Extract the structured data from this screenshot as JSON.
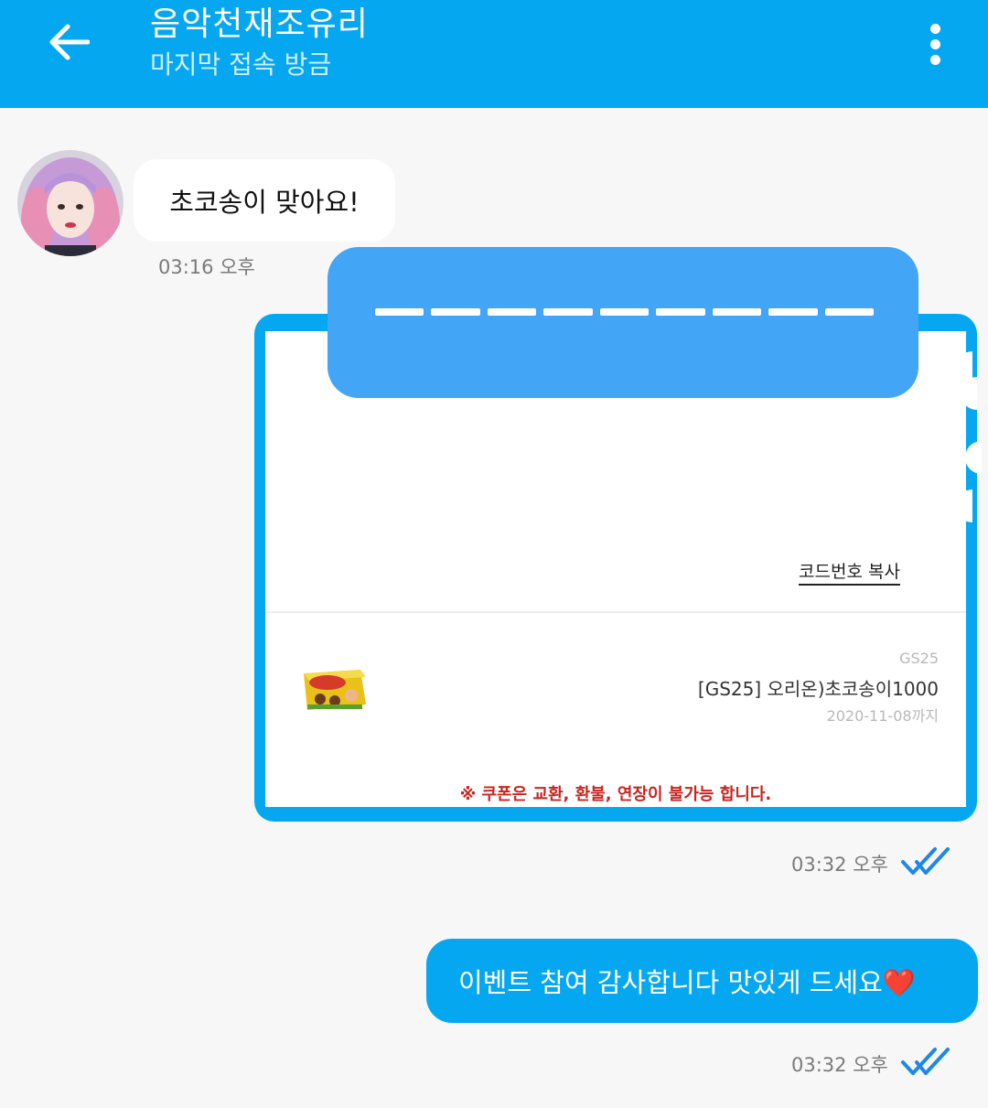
{
  "header": {
    "back_icon": "arrow-left-icon",
    "title": "음악천재조유리",
    "subtitle": "마지막 접속 방금",
    "menu_icon": "more-vertical-icon"
  },
  "messages": {
    "incoming": {
      "text": "초코송이 맞아요!",
      "time": "03:16 오후"
    },
    "coupon": {
      "copy_label": "코드번호 복사",
      "brand": "GS25",
      "product": "[GS25] 오리온)초코송이1000",
      "expiry": "2020-11-08까지",
      "notice": "※ 쿠폰은 교환, 환불, 연장이 불가능 합니다.",
      "time": "03:32 오후"
    },
    "outgoing": {
      "text": "이벤트 참여 감사합니다 맛있게 드세요❤️",
      "time": "03:32 오후"
    }
  },
  "colors": {
    "header": "#05a8f0",
    "bubble_out": "#05a8f0",
    "tick": "#1e88e5",
    "notice": "#c9241f"
  }
}
